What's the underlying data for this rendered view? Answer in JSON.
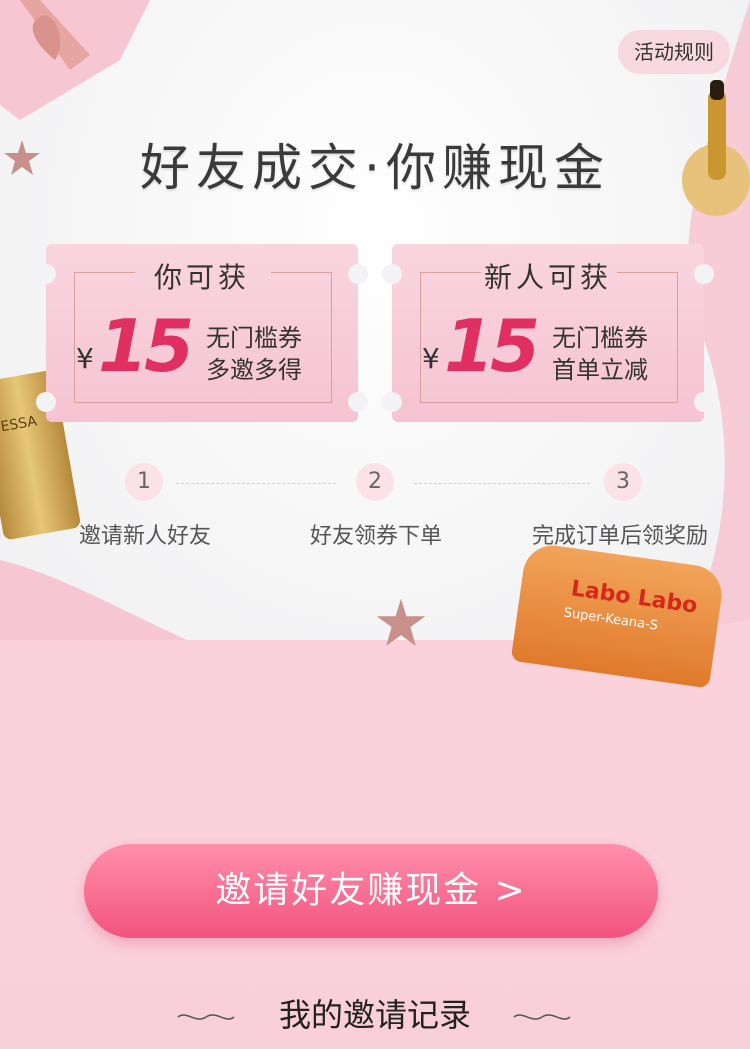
{
  "header": {
    "rules_label": "活动规则",
    "title": "好友成交·你赚现金"
  },
  "tickets": [
    {
      "head": "你可获",
      "currency": "¥",
      "amount": "15",
      "line1": "无门槛券",
      "line2": "多邀多得"
    },
    {
      "head": "新人可获",
      "currency": "¥",
      "amount": "15",
      "line1": "无门槛券",
      "line2": "首单立减"
    }
  ],
  "steps": [
    {
      "number": "1",
      "label": "邀请新人好友"
    },
    {
      "number": "2",
      "label": "好友领券下单"
    },
    {
      "number": "3",
      "label": "完成订单后领奖励"
    }
  ],
  "cta": {
    "label": "邀请好友赚现金 >"
  },
  "records": {
    "title": "我的邀请记录"
  },
  "product_labels": {
    "sunscreen": "ESSA",
    "jar_brand": "Labo Labo",
    "jar_sub": "Super-Keana-S"
  },
  "colors": {
    "accent": "#e03061",
    "cta_top": "#ff8fab",
    "cta_bottom": "#f2537f",
    "pink_bg": "#fbd2dc"
  }
}
